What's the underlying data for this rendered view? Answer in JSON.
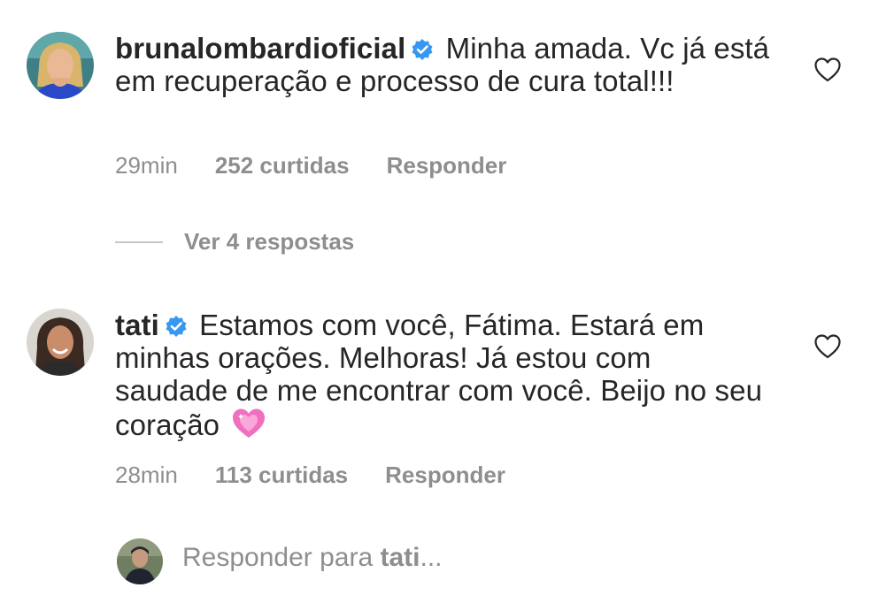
{
  "comments": [
    {
      "username": "brunalombardioficial",
      "verified": true,
      "text": " Minha amada. Vc já está em recuperação e processo de cura total!!!",
      "time": "29min",
      "likes": "252 curtidas",
      "reply_label": "Responder",
      "view_replies": "Ver 4 respostas",
      "avatar_icon": "avatar-blonde-woman"
    },
    {
      "username": "tati",
      "verified": true,
      "text": " Estamos com você, Fátima. Estará em minhas orações. Melhoras! Já estou com saudade de me encontrar com você. Beijo no seu coração ",
      "emoji": "sparkling-heart",
      "time": "28min",
      "likes": "113 curtidas",
      "reply_label": "Responder",
      "avatar_icon": "avatar-dark-hair-woman"
    }
  ],
  "reply_box": {
    "prefix": "Responder para ",
    "target": "tati",
    "suffix": "..."
  },
  "colors": {
    "text": "#262626",
    "muted": "#8e8e8e",
    "verified": "#3897f0",
    "emoji_heart": "#f06fbf"
  }
}
